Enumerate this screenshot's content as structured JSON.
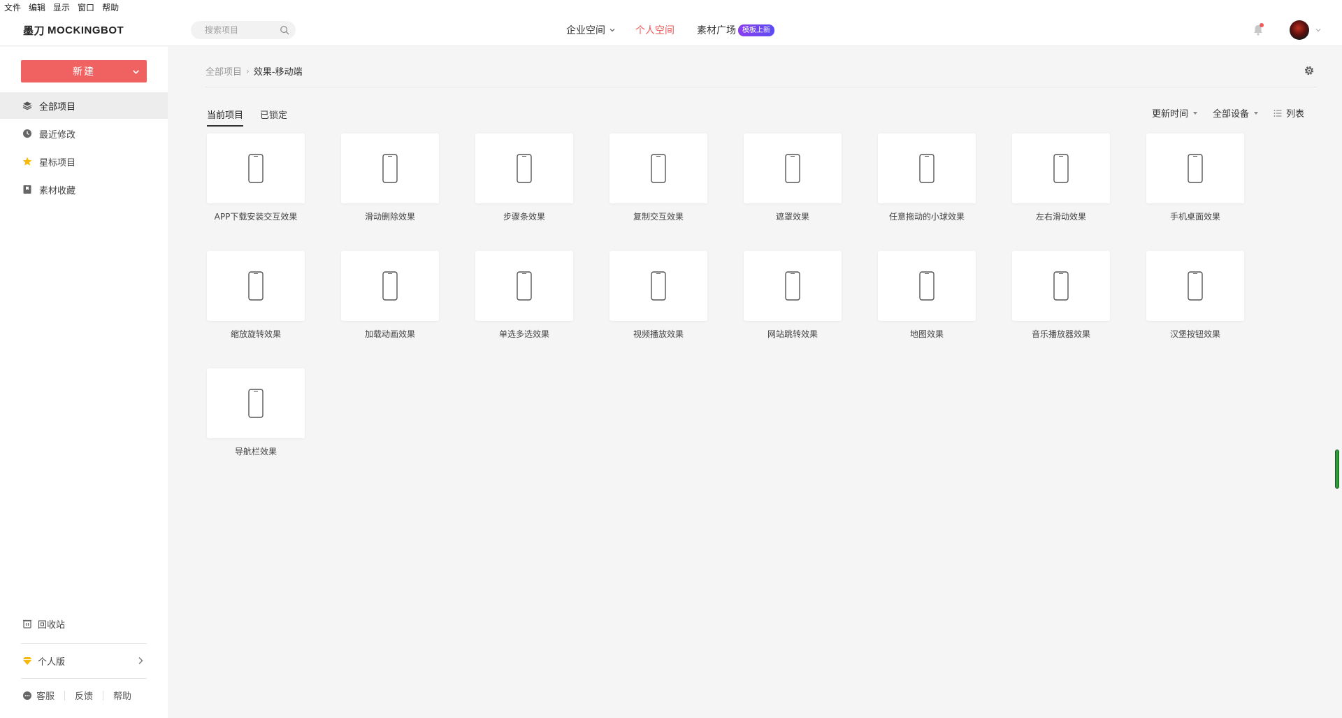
{
  "menubar": [
    "文件",
    "编辑",
    "显示",
    "窗口",
    "帮助"
  ],
  "header": {
    "logo_glyph": "墨刀",
    "logo_text": "MOCKINGBOT",
    "search_placeholder": "搜索项目",
    "nav": {
      "enterprise": "企业空间",
      "personal": "个人空间",
      "materials": "素材广场",
      "materials_badge": "模板上新"
    },
    "accent_color": "#ef5a5a"
  },
  "sidebar": {
    "new_button": "新建",
    "items": [
      {
        "label": "全部项目",
        "icon": "layers-icon",
        "active": true
      },
      {
        "label": "最近修改",
        "icon": "clock-icon",
        "active": false
      },
      {
        "label": "星标项目",
        "icon": "star-icon",
        "active": false
      },
      {
        "label": "素材收藏",
        "icon": "bookmark-icon",
        "active": false
      }
    ],
    "trash": "回收站",
    "plan": "个人版",
    "footer": {
      "service": "客服",
      "feedback": "反馈",
      "help": "帮助"
    }
  },
  "main": {
    "breadcrumb": {
      "root": "全部项目",
      "sep": "›",
      "current": "效果-移动端"
    },
    "tabs": [
      {
        "label": "当前项目",
        "active": true
      },
      {
        "label": "已锁定",
        "active": false
      }
    ],
    "filters": {
      "sort": "更新时间",
      "device": "全部设备",
      "view": "列表"
    },
    "projects": [
      "APP下载安装交互效果",
      "滑动删除效果",
      "步骤条效果",
      "复制交互效果",
      "遮罩效果",
      "任意拖动的小球效果",
      "左右滑动效果",
      "手机桌面效果",
      "缩放旋转效果",
      "加载动画效果",
      "单选多选效果",
      "视频播放效果",
      "网站跳转效果",
      "地图效果",
      "音乐播放器效果",
      "汉堡按钮效果",
      "导航栏效果"
    ]
  }
}
